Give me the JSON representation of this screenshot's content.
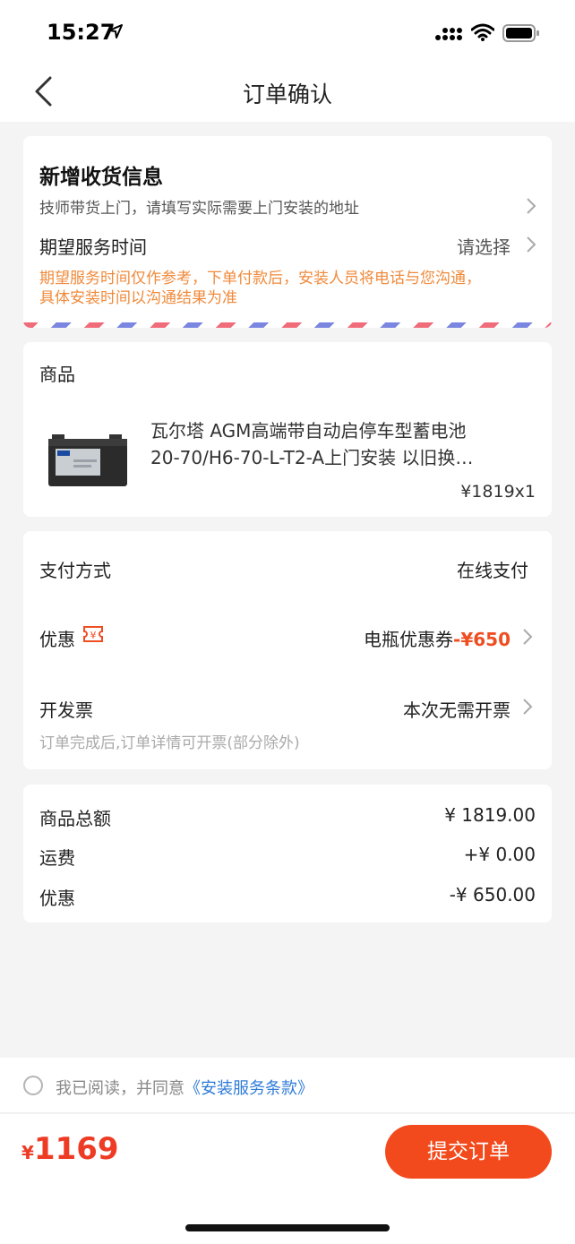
{
  "status_bar": {
    "time": "15:27",
    "icons": [
      "location-arrow-icon",
      "signal-icon",
      "wifi-icon",
      "battery-icon"
    ]
  },
  "nav": {
    "title": "订单确认",
    "back_icon": "chevron-left-icon"
  },
  "address": {
    "title": "新增收货信息",
    "subtitle": "技师带货上门，请填写实际需要上门安装的地址",
    "service_time_label": "期望服务时间",
    "service_time_value": "请选择",
    "service_note_line1": "期望服务时间仅作参考，下单付款后，安装人员将电话与您沟通，",
    "service_note_line2": "具体安装时间以沟通结果为准"
  },
  "product": {
    "header": "商品",
    "name_line1": "瓦尔塔 AGM高端带自动启停车型蓄电池",
    "name_line2": "20-70/H6-70-L-T2-A上门安装 以旧换…",
    "price": "¥1819x1"
  },
  "payment": {
    "method_label": "支付方式",
    "method_value": "在线支付",
    "discount_label": "优惠",
    "coupon_name": "电瓶优惠券",
    "coupon_amount": "-¥650",
    "invoice_label": "开发票",
    "invoice_value": "本次无需开票",
    "invoice_note": "订单完成后,订单详情可开票(部分除外)"
  },
  "summary": {
    "items_total_label": "商品总额",
    "items_total_value": "¥ 1819.00",
    "shipping_label": "运费",
    "shipping_value": "+¥ 0.00",
    "discount_label": "优惠",
    "discount_value": "-¥ 650.00"
  },
  "agreement": {
    "text": "我已阅读，并同意",
    "link": "《安装服务条款》",
    "checked": false
  },
  "footer": {
    "currency": "¥",
    "total": "1169",
    "submit_label": "提交订单"
  },
  "colors": {
    "accent": "#f24a1c",
    "price_red": "#ee3b24",
    "note_orange": "#f08a3b",
    "link_blue": "#2f7bd8"
  }
}
